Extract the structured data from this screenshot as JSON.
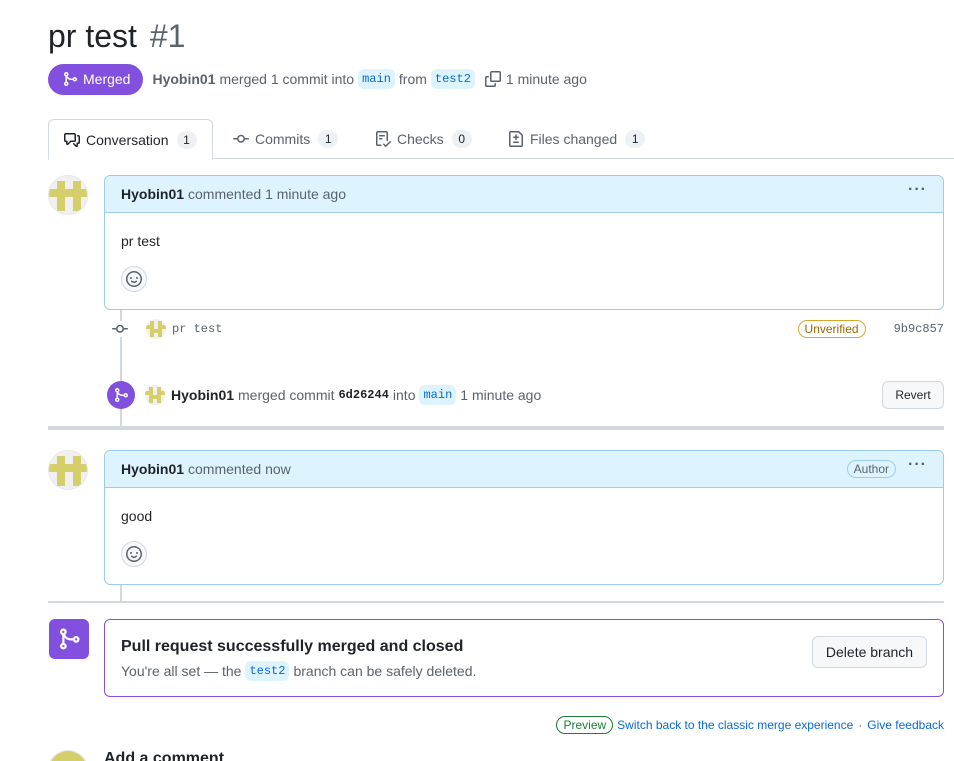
{
  "pr": {
    "title": "pr test",
    "number": "#1",
    "state_label": "Merged",
    "author": "Hyobin01",
    "merge_text": "merged 1 commit into",
    "base_branch": "main",
    "from_text": "from",
    "head_branch": "test2",
    "time": "1 minute ago"
  },
  "tabs": [
    {
      "label": "Conversation",
      "count": "1",
      "icon": "comment-discussion-icon"
    },
    {
      "label": "Commits",
      "count": "1",
      "icon": "git-commit-icon"
    },
    {
      "label": "Checks",
      "count": "0",
      "icon": "checklist-icon"
    },
    {
      "label": "Files changed",
      "count": "1",
      "icon": "file-diff-icon"
    }
  ],
  "comments": [
    {
      "author": "Hyobin01",
      "action": "commented",
      "time": "1 minute ago",
      "body": "pr test",
      "badge": ""
    },
    {
      "author": "Hyobin01",
      "action": "commented",
      "time": "now",
      "body": "good",
      "badge": "Author"
    }
  ],
  "commit": {
    "message": "pr test",
    "verification": "Unverified",
    "sha": "9b9c857"
  },
  "merge_event": {
    "user": "Hyobin01",
    "text": "merged commit",
    "sha": "6d26244",
    "into_text": "into",
    "branch": "main",
    "time": "1 minute ago",
    "revert_label": "Revert"
  },
  "merged_box": {
    "title": "Pull request successfully merged and closed",
    "desc_before": "You're all set — the",
    "branch": "test2",
    "desc_after": "branch can be safely deleted.",
    "delete_label": "Delete branch"
  },
  "footer": {
    "preview_label": "Preview",
    "switch_link": "Switch back to the classic merge experience",
    "separator": "·",
    "feedback_link": "Give feedback"
  },
  "add_comment": {
    "title": "Add a comment"
  },
  "colors": {
    "merged_purple": "#8250df",
    "link_blue": "#0969da",
    "comment_header_bg": "#ddf4ff",
    "avatar_yellow": "#d4cf6a"
  }
}
